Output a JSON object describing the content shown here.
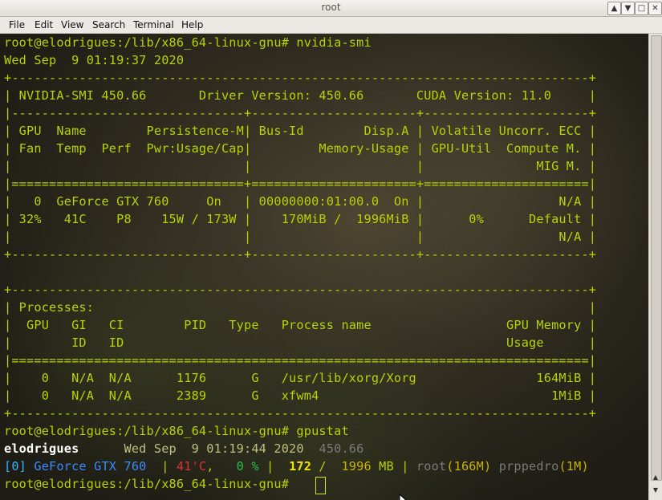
{
  "window": {
    "title": "root",
    "buttons": [
      "▲",
      "▼",
      "□",
      "✕"
    ]
  },
  "menu": [
    "File",
    "Edit",
    "View",
    "Search",
    "Terminal",
    "Help"
  ],
  "terminal": {
    "prompt": "root@elodrigues:/lib/x86_64-linux-gnu#",
    "cmd1": " nvidia-smi",
    "date1": "Wed Sep  9 01:19:37 2020",
    "lines": [
      "+-----------------------------------------------------------------------------+",
      "| NVIDIA-SMI 450.66       Driver Version: 450.66       CUDA Version: 11.0     |",
      "|-------------------------------+----------------------+----------------------+",
      "| GPU  Name        Persistence-M| Bus-Id        Disp.A | Volatile Uncorr. ECC |",
      "| Fan  Temp  Perf  Pwr:Usage/Cap|         Memory-Usage | GPU-Util  Compute M. |",
      "|                               |                      |               MIG M. |",
      "|===============================+======================+======================|",
      "|   0  GeForce GTX 760     On   | 00000000:01:00.0  On |                  N/A |",
      "| 32%   41C    P8    15W / 173W |    170MiB /  1996MiB |      0%      Default |",
      "|                               |                      |                  N/A |",
      "+-------------------------------+----------------------+----------------------+",
      "",
      "+-----------------------------------------------------------------------------+",
      "| Processes:                                                                  |",
      "|  GPU   GI   CI        PID   Type   Process name                  GPU Memory |",
      "|        ID   ID                                                   Usage      |",
      "|=============================================================================|",
      "|    0   N/A  N/A      1176      G   /usr/lib/xorg/Xorg                164MiB |",
      "|    0   N/A  N/A      2389      G   xfwm4                               1MiB |",
      "+-----------------------------------------------------------------------------+"
    ],
    "cmd2": " gpustat",
    "gpustat": {
      "host": "elodrigues",
      "date": "Wed Sep  9 01:19:44 2020",
      "driver": "450.66",
      "index": "[0]",
      "gpu_name": "GeForce GTX 760",
      "sep1": "  | ",
      "temp": "41'C",
      "comma": ",",
      "util": "   0 %",
      "sep2": " |  ",
      "mem_used": "172",
      "mem_slash": " /  ",
      "mem_total": "1996",
      "mem_unit": " MB",
      "sep3": " | ",
      "user1": "root",
      "user1_mem": "(166M)",
      "user2": "prppedro",
      "user2_mem": "(1M)"
    }
  }
}
